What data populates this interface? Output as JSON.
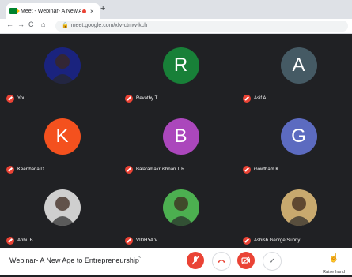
{
  "browser": {
    "tab_title": "Meet - Webinar- A New Age",
    "tab_close": "×",
    "new_tab": "+",
    "url": "meet.google.com/xfv-ctmw-kch"
  },
  "participants": [
    {
      "name": "You",
      "avatar_letter": "",
      "avatar_color": "#1a237e"
    },
    {
      "name": "Revathy T",
      "avatar_letter": "R",
      "avatar_color": "#188038"
    },
    {
      "name": "Asif A",
      "avatar_letter": "A",
      "avatar_color": "#455a64"
    },
    {
      "name": "Keerthana D",
      "avatar_letter": "K",
      "avatar_color": "#f4511e"
    },
    {
      "name": "Balaramakrushnan T R",
      "avatar_letter": "B",
      "avatar_color": "#ab47bc"
    },
    {
      "name": "Gowtham K",
      "avatar_letter": "G",
      "avatar_color": "#5c6bc0"
    },
    {
      "name": "Anbu B",
      "avatar_letter": "",
      "avatar_color": "#cfcfcf"
    },
    {
      "name": "VIDHYA V",
      "avatar_letter": "",
      "avatar_color": "#4caf50"
    },
    {
      "name": "Ashish George Sunny",
      "avatar_letter": "",
      "avatar_color": "#c8a96e"
    }
  ],
  "bottom_bar": {
    "meeting_title": "Webinar- A New Age to Entrepreneurship",
    "caret": "^",
    "raise_hand_label": "Raise hand"
  },
  "colors": {
    "danger": "#ea4335",
    "background": "#202124"
  }
}
